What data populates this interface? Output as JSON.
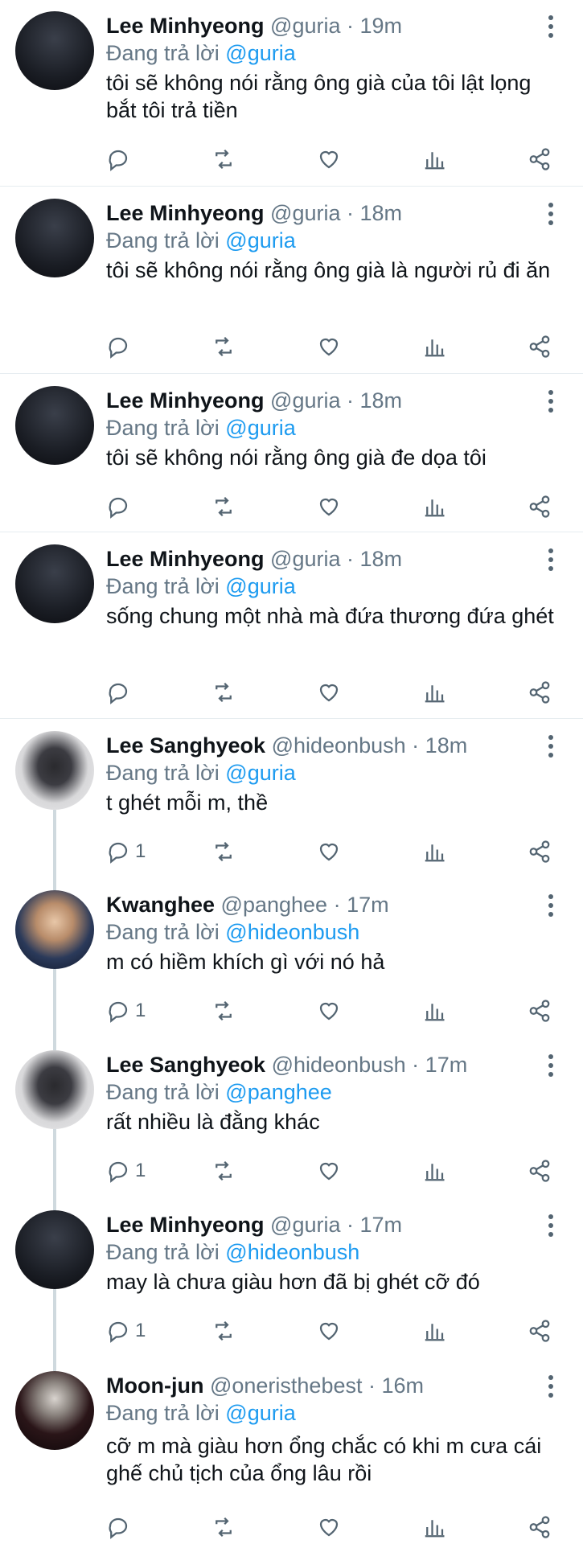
{
  "reply_prefix": "Đang trả lời",
  "icons": {
    "reply": "reply-icon",
    "retweet": "retweet-icon",
    "like": "heart-icon",
    "analytics": "analytics-icon",
    "share": "share-icon",
    "more": "more-vertical-icon"
  },
  "tweets": [
    {
      "name": "Lee Minhyeong",
      "handle": "@guria",
      "dot": "·",
      "time": "19m",
      "reply_to": "@guria",
      "text": "tôi sẽ không nói rằng ông già của tôi lật lọng bắt tôi trả tiền",
      "reply_count": ""
    },
    {
      "name": "Lee Minhyeong",
      "handle": "@guria",
      "dot": "·",
      "time": "18m",
      "reply_to": "@guria",
      "text": "tôi sẽ không nói rằng ông già là người rủ đi ăn",
      "reply_count": ""
    },
    {
      "name": "Lee Minhyeong",
      "handle": "@guria",
      "dot": "·",
      "time": "18m",
      "reply_to": "@guria",
      "text": "tôi sẽ không nói rằng ông già đe dọa tôi",
      "reply_count": ""
    },
    {
      "name": "Lee Minhyeong",
      "handle": "@guria",
      "dot": "·",
      "time": "18m",
      "reply_to": "@guria",
      "text": "sống chung một nhà mà đứa thương đứa ghét",
      "reply_count": ""
    },
    {
      "name": "Lee Sanghyeok",
      "handle": "@hideonbush",
      "dot": "·",
      "time": "18m",
      "reply_to": "@guria",
      "text": "t ghét mỗi m, thề",
      "reply_count": "1"
    },
    {
      "name": "Kwanghee",
      "handle": "@panghee",
      "dot": "·",
      "time": "17m",
      "reply_to": "@hideonbush",
      "text": "m có hiềm khích gì với nó hả",
      "reply_count": "1"
    },
    {
      "name": "Lee Sanghyeok",
      "handle": "@hideonbush",
      "dot": "·",
      "time": "17m",
      "reply_to": "@panghee",
      "text": "rất nhiều là đằng khác",
      "reply_count": "1"
    },
    {
      "name": "Lee Minhyeong",
      "handle": "@guria",
      "dot": "·",
      "time": "17m",
      "reply_to": "@hideonbush",
      "text": "may là chưa giàu hơn đã bị ghét cỡ đó",
      "reply_count": "1"
    },
    {
      "name": "Moon-jun",
      "handle": "@oneristhebest",
      "dot": "·",
      "time": "16m",
      "reply_to": "@guria",
      "text": "cỡ m mà giàu hơn ổng chắc có khi m cưa cái ghế chủ tịch của ổng lâu rồi",
      "reply_count": ""
    }
  ]
}
